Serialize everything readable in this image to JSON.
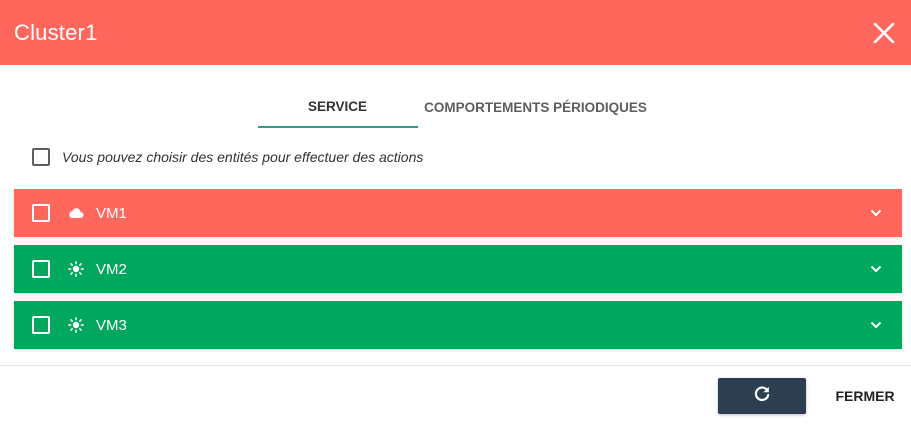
{
  "header": {
    "title": "Cluster1",
    "background": "#ff675d"
  },
  "tabs": [
    {
      "label": "SERVICE",
      "active": true
    },
    {
      "label": "COMPORTEMENTS PÉRIODIQUES",
      "active": false
    }
  ],
  "selection": {
    "hint": "Vous pouvez choisir des entités pour effectuer des actions",
    "checked": false
  },
  "entities": [
    {
      "name": "VM1",
      "state_icon": "cloud-icon",
      "color": "#ff675d",
      "checked": false
    },
    {
      "name": "VM2",
      "state_icon": "sun-icon",
      "color": "#00a75f",
      "checked": false
    },
    {
      "name": "VM3",
      "state_icon": "sun-icon",
      "color": "#00a75f",
      "checked": false
    }
  ],
  "footer": {
    "refresh_icon": "refresh-icon",
    "close_label": "FERMER",
    "refresh_color": "#2c3e50"
  },
  "colors": {
    "accent": "#2f9c83",
    "danger": "#ff675d",
    "ok": "#00a75f"
  }
}
